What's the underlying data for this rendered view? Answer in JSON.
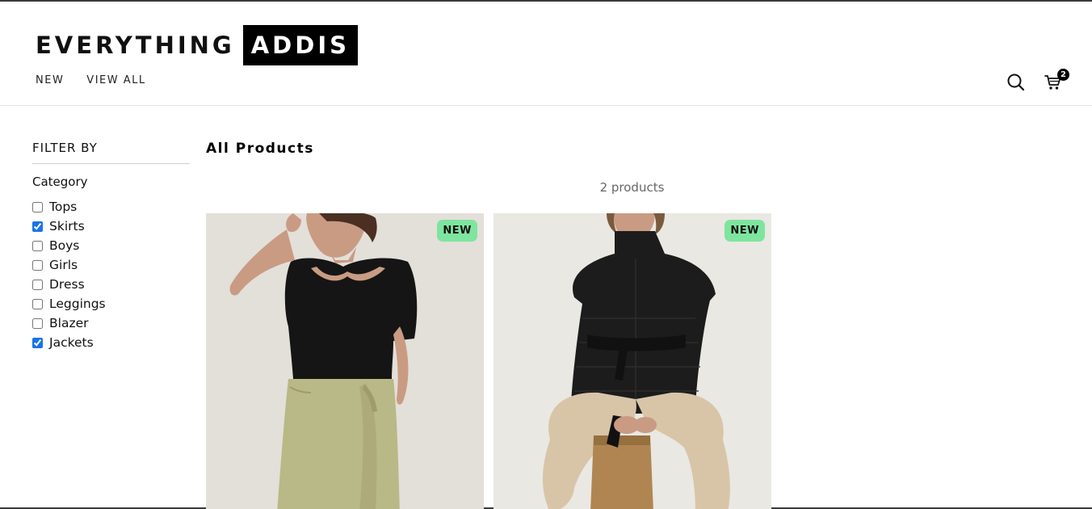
{
  "brand": {
    "part1": "EVERYTHING",
    "part2": "ADDIS"
  },
  "nav": {
    "new": "NEW",
    "view_all": "VIEW ALL"
  },
  "cart": {
    "count": "2"
  },
  "sidebar": {
    "filter_title": "FILTER BY",
    "category_title": "Category",
    "categories": [
      {
        "label": "Tops",
        "checked": false
      },
      {
        "label": "Skirts",
        "checked": true
      },
      {
        "label": "Boys",
        "checked": false
      },
      {
        "label": "Girls",
        "checked": false
      },
      {
        "label": "Dress",
        "checked": false
      },
      {
        "label": "Leggings",
        "checked": false
      },
      {
        "label": "Blazer",
        "checked": false
      },
      {
        "label": "Jackets",
        "checked": true
      }
    ]
  },
  "main": {
    "title": "All Products",
    "count_text": "2 products",
    "products": [
      {
        "badge": "NEW"
      },
      {
        "badge": "NEW"
      }
    ]
  },
  "colors": {
    "badge_bg": "#7ee59f",
    "logo_bg": "#000000",
    "checkbox_accent": "#1a73e8"
  }
}
